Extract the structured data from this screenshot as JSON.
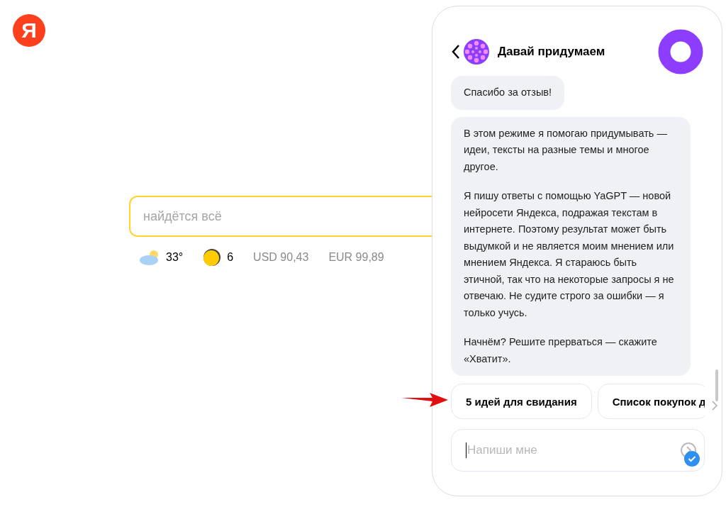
{
  "logo": {
    "letter": "Я"
  },
  "search": {
    "placeholder": "найдётся всё"
  },
  "informers": [
    {
      "kind": "weather",
      "text": "33°"
    },
    {
      "kind": "traffic",
      "text": "6"
    },
    {
      "kind": "rate",
      "text": "USD 90,43"
    },
    {
      "kind": "rate",
      "text": "EUR 99,89"
    }
  ],
  "chat": {
    "title": "Давай придумаем",
    "messages": [
      {
        "paragraphs": [
          "Спасибо за отзыв!"
        ]
      },
      {
        "paragraphs": [
          "В этом режиме я помогаю придумывать — идеи, тексты на разные темы и многое другое.",
          "Я пишу ответы с помощью YaGPT — новой нейросети Яндекса, подражая текстам в интернете. Поэтому результат может быть выдумкой и не является моим мнением или мнением Яндекса. Я стараюсь быть этичной, так что на некоторые запросы я не отвечаю. Не судите строго за ошибки — я только учусь.",
          "Начнём? Решите прерваться — скажите «Хватит»."
        ]
      }
    ],
    "suggestions": [
      {
        "label": "5 идей для свидания"
      },
      {
        "label": "Список покупок д"
      }
    ],
    "input": {
      "placeholder": "Напиши мне"
    }
  }
}
